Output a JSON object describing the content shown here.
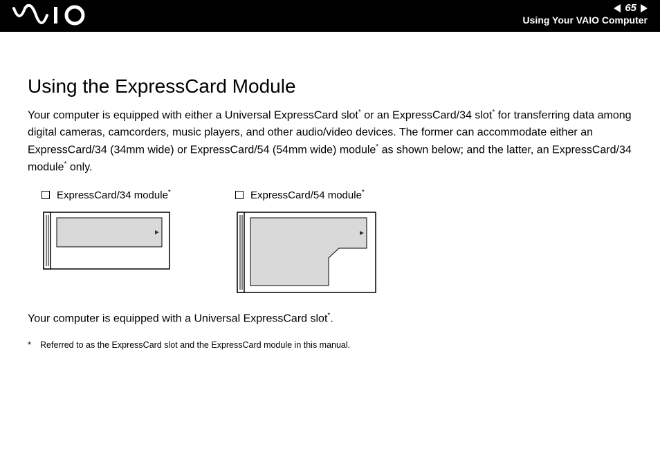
{
  "header": {
    "page_number": "65",
    "section": "Using Your VAIO Computer"
  },
  "title": "Using the ExpressCard Module",
  "intro_parts": {
    "p1a": "Your computer is equipped with either a Universal ExpressCard slot",
    "p1b": " or an ExpressCard/34 slot",
    "p1c": " for transferring data among digital cameras, camcorders, music players, and other audio/video devices. The former can accommodate either an ExpressCard/34 (34mm wide) or ExpressCard/54 (54mm wide) module",
    "p1d": " as shown below; and the latter, an ExpressCard/34 module",
    "p1e": " only."
  },
  "modules": {
    "m34": "ExpressCard/34 module",
    "m54": "ExpressCard/54 module"
  },
  "line2a": "Your computer is equipped with a Universal ExpressCard slot",
  "line2b": ".",
  "footnote_mark": "*",
  "footnote": "Referred to as the ExpressCard slot and the ExpressCard module in this manual.",
  "asterisk": "*"
}
